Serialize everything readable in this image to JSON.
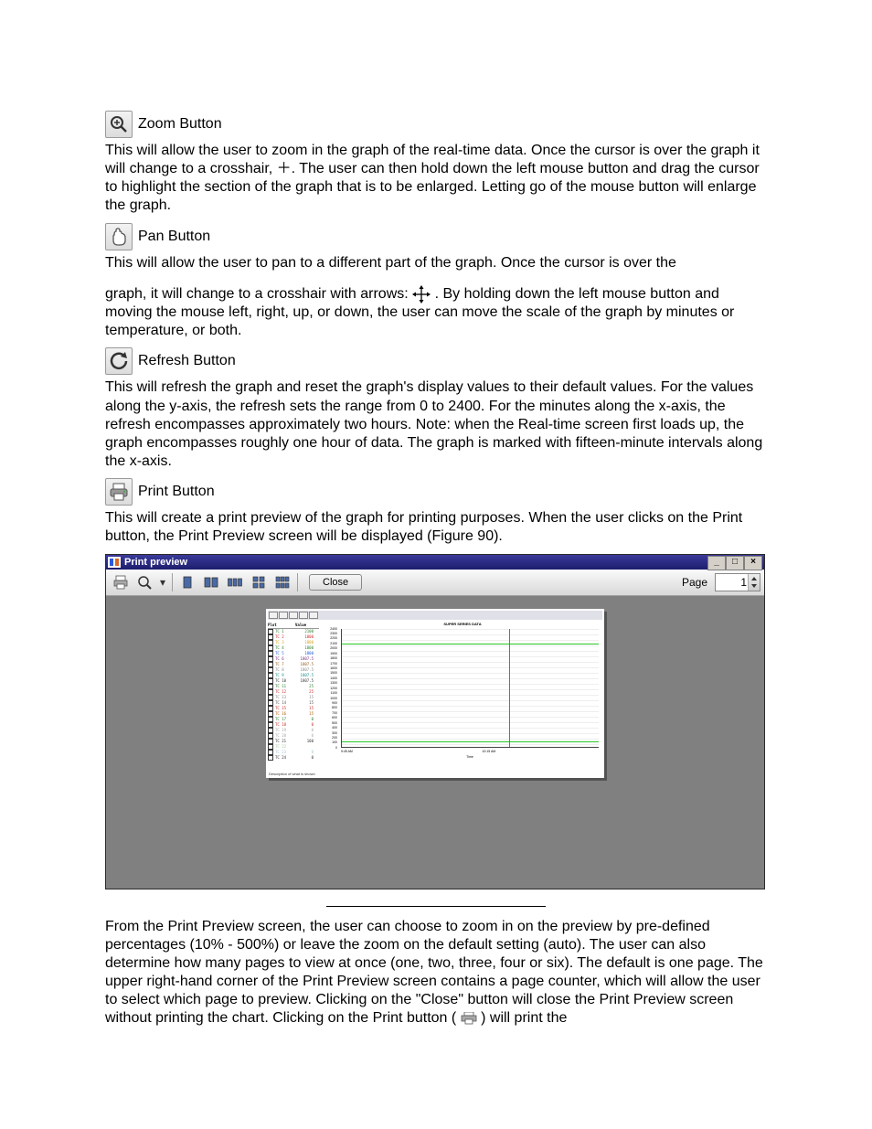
{
  "sections": {
    "zoom": {
      "title": "Zoom Button",
      "body": "This will allow the user to zoom in the graph of the real-time data.  Once the cursor is over the graph it will change to a crosshair, ＋.  The user can then hold down the left mouse button and drag the cursor to highlight the section of the graph that is to be enlarged.  Letting go of the mouse button will enlarge the graph."
    },
    "pan": {
      "title": "Pan Button",
      "body1": "This will allow the user to pan to a different part of the graph.  Once the cursor is over the",
      "body2_pre": "graph, it will change to a crosshair with arrows:  ",
      "body2_post": "  . By holding down the left mouse button and moving the mouse left, right, up, or down, the user can move the scale of the graph by minutes or temperature, or both."
    },
    "refresh": {
      "title": "Refresh Button",
      "body": "This will refresh the graph and reset the graph's display values to their default values. For the values along the y-axis, the refresh sets the range from 0 to 2400.  For the minutes along the x-axis, the refresh encompasses approximately two hours.  Note: when the Real-time screen first loads up, the graph encompasses roughly one hour of data.  The graph is marked with fifteen-minute intervals along the x-axis."
    },
    "print": {
      "title": "Print Button",
      "body": "This will create a print preview of the graph for printing purposes.  When the user clicks on the Print button, the Print Preview screen will be displayed (Figure 90)."
    },
    "after": {
      "body_pre": "From the Print Preview screen, the user can choose to zoom in on the preview by pre-defined percentages (10% - 500%) or leave the zoom on the default setting (auto).  The user can also determine how many pages to view at once (one, two, three, four or six).  The default is one page.  The upper right-hand corner of the Print Preview screen contains a page counter, which will allow the user to select which page to preview.  Clicking on the \"Close\" button will close the Print Preview screen without printing the chart.  Clicking on the Print button (",
      "body_post": ") will print the"
    }
  },
  "preview_window": {
    "title": "Print preview",
    "close_label": "Close",
    "page_label": "Page",
    "page_value": "1"
  },
  "chart_data": {
    "type": "line",
    "title": "SUPER SERIES DATA",
    "xlabel": "Time",
    "ylabel": "",
    "ylim": [
      0,
      2400
    ],
    "y_ticks": [
      2400,
      2300,
      2200,
      2100,
      2000,
      1900,
      1800,
      1700,
      1600,
      1500,
      1400,
      1300,
      1200,
      1100,
      1000,
      900,
      800,
      700,
      600,
      500,
      400,
      300,
      200,
      100,
      0
    ],
    "x_ticks": [
      "9:45 AM",
      "10:15 AM"
    ],
    "list_header": [
      "Plot",
      "Value"
    ],
    "footer": "Description of what is shown",
    "series": [
      {
        "name": "TC 1",
        "value": 2100,
        "color": "#2a7e2a"
      },
      {
        "name": "TC 2",
        "value": 1800,
        "color": "#c92a2a"
      },
      {
        "name": "TC 3",
        "value": 1800,
        "color": "#d6a21a"
      },
      {
        "name": "TC 4",
        "value": 1800,
        "color": "#2a7e2a"
      },
      {
        "name": "TC 5",
        "value": 1800,
        "color": "#1a5ad6"
      },
      {
        "name": "TC 6",
        "value": 1807.5,
        "color": "#7a2a7a"
      },
      {
        "name": "TC 7",
        "value": 1807.5,
        "color": "#8c5a1a"
      },
      {
        "name": "TC 8",
        "value": 1807.5,
        "color": "#888888"
      },
      {
        "name": "TC 9",
        "value": 1807.5,
        "color": "#1a8c8c"
      },
      {
        "name": "TC 10",
        "value": 1807.5,
        "color": "#333333"
      },
      {
        "name": "TC 11",
        "value": 25,
        "color": "#2a7e2a"
      },
      {
        "name": "TC 12",
        "value": 25,
        "color": "#c92a2a"
      },
      {
        "name": "TC 13",
        "value": 15,
        "color": "#888888"
      },
      {
        "name": "TC 14",
        "value": 15,
        "color": "#555555"
      },
      {
        "name": "TC 15",
        "value": 15,
        "color": "#c92a2a"
      },
      {
        "name": "TC 16",
        "value": 15,
        "color": "#b55a00"
      },
      {
        "name": "TC 17",
        "value": 0,
        "color": "#2a7e2a"
      },
      {
        "name": "TC 18",
        "value": 0,
        "color": "#c92a2a"
      },
      {
        "name": "TC 19",
        "value": 0,
        "color": "#a8a8a8"
      },
      {
        "name": "TC 20",
        "value": 0,
        "color": "#a8a8a8"
      },
      {
        "name": "TC 21",
        "value": 100,
        "color": "#333333"
      },
      {
        "name": "TC 22",
        "value": "",
        "color": "#a8c8a8"
      },
      {
        "name": "TC 23",
        "value": 0,
        "color": "#a8c8d8"
      },
      {
        "name": "TC 24",
        "value": 0,
        "color": "#333333"
      }
    ],
    "plot_lines": [
      {
        "y": 2100,
        "color": "#2ac92a"
      },
      {
        "y": 100,
        "color": "#2ac92a"
      },
      {
        "x_rel": 0.65,
        "color": "#d62ad6"
      }
    ]
  }
}
